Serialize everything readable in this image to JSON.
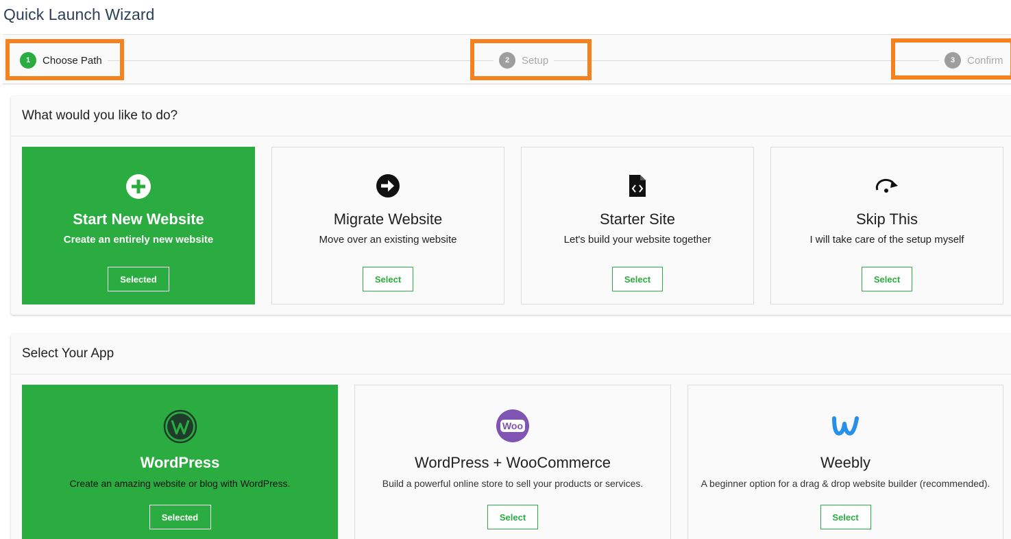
{
  "page": {
    "title": "Quick Launch Wizard"
  },
  "stepper": {
    "steps": [
      {
        "number": "1",
        "label": "Choose Path",
        "state": "active"
      },
      {
        "number": "2",
        "label": "Setup",
        "state": "inactive"
      },
      {
        "number": "3",
        "label": "Confirm",
        "state": "inactive"
      }
    ]
  },
  "colors": {
    "accent": "#2aac40",
    "highlight": "#f5821f",
    "inactive_step": "#9e9e9e",
    "woo_purple": "#7f54b3",
    "weebly_blue": "#2990ea"
  },
  "paths": {
    "heading": "What would you like to do?",
    "cards": [
      {
        "icon": "plus-circle-icon",
        "title": "Start New Website",
        "description": "Create an entirely new website",
        "button": "Selected",
        "selected": true
      },
      {
        "icon": "arrow-right-circle-icon",
        "title": "Migrate Website",
        "description": "Move over an existing website",
        "button": "Select",
        "selected": false
      },
      {
        "icon": "code-file-icon",
        "title": "Starter Site",
        "description": "Let's build your website together",
        "button": "Select",
        "selected": false
      },
      {
        "icon": "redo-arrow-icon",
        "title": "Skip This",
        "description": "I will take care of the setup myself",
        "button": "Select",
        "selected": false
      }
    ]
  },
  "apps": {
    "heading": "Select Your App",
    "cards": [
      {
        "icon": "wordpress-logo-icon",
        "title": "WordPress",
        "description": "Create an amazing website or blog with WordPress.",
        "button": "Selected",
        "selected": true
      },
      {
        "icon": "woocommerce-logo-icon",
        "title": "WordPress + WooCommerce",
        "description": "Build a powerful online store to sell your products or services.",
        "button": "Select",
        "selected": false,
        "logo_text": "Woo"
      },
      {
        "icon": "weebly-logo-icon",
        "title": "Weebly",
        "description": "A beginner option for a drag & drop website builder (recommended).",
        "button": "Select",
        "selected": false
      }
    ]
  }
}
